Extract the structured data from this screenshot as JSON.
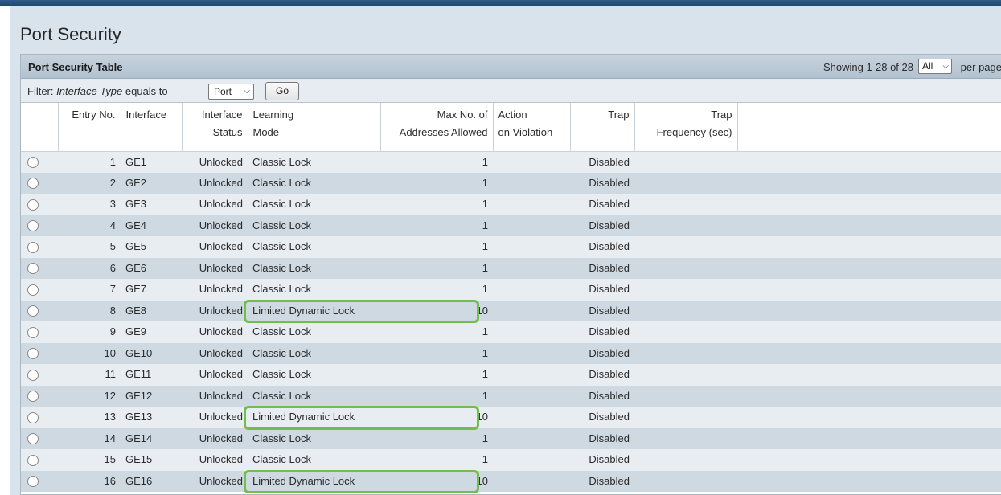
{
  "page": {
    "title": "Port Security"
  },
  "table_header": {
    "title": "Port Security Table",
    "showing": "Showing 1-28 of 28",
    "per_page_value": "All",
    "per_page_label": "per page"
  },
  "filter": {
    "label_prefix": "Filter: ",
    "label_field": "Interface Type",
    "label_suffix": " equals to",
    "select_value": "Port",
    "go_label": "Go"
  },
  "columns": [
    {
      "line1": "",
      "line2": ""
    },
    {
      "line1": "Entry No.",
      "line2": ""
    },
    {
      "line1": "Interface",
      "line2": ""
    },
    {
      "line1": "Interface",
      "line2": "Status"
    },
    {
      "line1": "Learning",
      "line2": "Mode"
    },
    {
      "line1": "Max No. of",
      "line2": "Addresses Allowed"
    },
    {
      "line1": "Action",
      "line2": "on Violation"
    },
    {
      "line1": "Trap",
      "line2": ""
    },
    {
      "line1": "Trap",
      "line2": "Frequency (sec)"
    },
    {
      "line1": "",
      "line2": ""
    }
  ],
  "rows": [
    {
      "entry": "1",
      "interface": "GE1",
      "status": "Unlocked",
      "mode": "Classic Lock",
      "max": "1",
      "action": "",
      "trap": "Disabled",
      "freq": "",
      "highlight": false
    },
    {
      "entry": "2",
      "interface": "GE2",
      "status": "Unlocked",
      "mode": "Classic Lock",
      "max": "1",
      "action": "",
      "trap": "Disabled",
      "freq": "",
      "highlight": false
    },
    {
      "entry": "3",
      "interface": "GE3",
      "status": "Unlocked",
      "mode": "Classic Lock",
      "max": "1",
      "action": "",
      "trap": "Disabled",
      "freq": "",
      "highlight": false
    },
    {
      "entry": "4",
      "interface": "GE4",
      "status": "Unlocked",
      "mode": "Classic Lock",
      "max": "1",
      "action": "",
      "trap": "Disabled",
      "freq": "",
      "highlight": false
    },
    {
      "entry": "5",
      "interface": "GE5",
      "status": "Unlocked",
      "mode": "Classic Lock",
      "max": "1",
      "action": "",
      "trap": "Disabled",
      "freq": "",
      "highlight": false
    },
    {
      "entry": "6",
      "interface": "GE6",
      "status": "Unlocked",
      "mode": "Classic Lock",
      "max": "1",
      "action": "",
      "trap": "Disabled",
      "freq": "",
      "highlight": false
    },
    {
      "entry": "7",
      "interface": "GE7",
      "status": "Unlocked",
      "mode": "Classic Lock",
      "max": "1",
      "action": "",
      "trap": "Disabled",
      "freq": "",
      "highlight": false
    },
    {
      "entry": "8",
      "interface": "GE8",
      "status": "Unlocked",
      "mode": "Limited Dynamic Lock",
      "max": "10",
      "action": "",
      "trap": "Disabled",
      "freq": "",
      "highlight": true
    },
    {
      "entry": "9",
      "interface": "GE9",
      "status": "Unlocked",
      "mode": "Classic Lock",
      "max": "1",
      "action": "",
      "trap": "Disabled",
      "freq": "",
      "highlight": false
    },
    {
      "entry": "10",
      "interface": "GE10",
      "status": "Unlocked",
      "mode": "Classic Lock",
      "max": "1",
      "action": "",
      "trap": "Disabled",
      "freq": "",
      "highlight": false
    },
    {
      "entry": "11",
      "interface": "GE11",
      "status": "Unlocked",
      "mode": "Classic Lock",
      "max": "1",
      "action": "",
      "trap": "Disabled",
      "freq": "",
      "highlight": false
    },
    {
      "entry": "12",
      "interface": "GE12",
      "status": "Unlocked",
      "mode": "Classic Lock",
      "max": "1",
      "action": "",
      "trap": "Disabled",
      "freq": "",
      "highlight": false
    },
    {
      "entry": "13",
      "interface": "GE13",
      "status": "Unlocked",
      "mode": "Limited Dynamic Lock",
      "max": "10",
      "action": "",
      "trap": "Disabled",
      "freq": "",
      "highlight": true
    },
    {
      "entry": "14",
      "interface": "GE14",
      "status": "Unlocked",
      "mode": "Classic Lock",
      "max": "1",
      "action": "",
      "trap": "Disabled",
      "freq": "",
      "highlight": false
    },
    {
      "entry": "15",
      "interface": "GE15",
      "status": "Unlocked",
      "mode": "Classic Lock",
      "max": "1",
      "action": "",
      "trap": "Disabled",
      "freq": "",
      "highlight": false
    },
    {
      "entry": "16",
      "interface": "GE16",
      "status": "Unlocked",
      "mode": "Limited Dynamic Lock",
      "max": "10",
      "action": "",
      "trap": "Disabled",
      "freq": "",
      "highlight": true
    }
  ],
  "colors": {
    "highlight": "#6ebf4d",
    "row_light": "#e8edf2",
    "row_dark": "#ced9e2",
    "topbar": "#1f4870"
  }
}
